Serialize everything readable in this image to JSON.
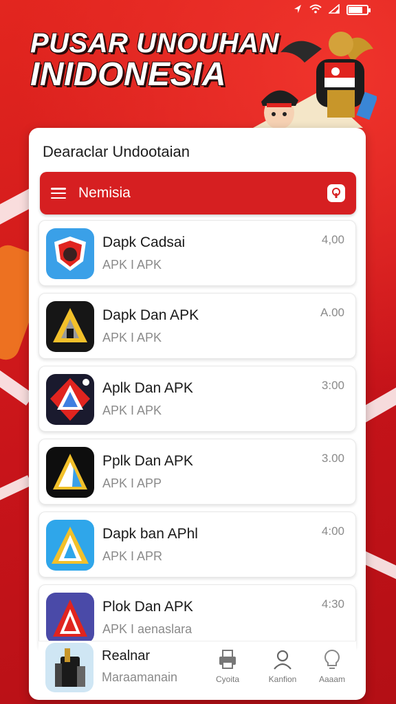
{
  "status_bar": {
    "icons": [
      "navigation-icon",
      "wifi-icon",
      "signal-icon",
      "battery-icon"
    ],
    "battery_level": 0.7
  },
  "hero": {
    "title_line1": "PUSAR UNOUHAN",
    "title_line2": "INIDONESIA"
  },
  "card": {
    "title": "Dearaclar Undootaian"
  },
  "menu": {
    "label": "Nemisia",
    "menu_icon": "hamburger-icon",
    "profile_icon": "profile-icon"
  },
  "apps": [
    {
      "name": "Dapk Cadsai",
      "sub": "APK I APK",
      "version": "4,00",
      "icon": "shield-icon"
    },
    {
      "name": "Dapk Dan APK",
      "sub": "APK I APK",
      "version": "A.00",
      "icon": "triangle-dark-icon"
    },
    {
      "name": "Aplk Dan APK",
      "sub": "APK I APK",
      "version": "3:00",
      "icon": "triangle-red-icon"
    },
    {
      "name": "Pplk Dan APK",
      "sub": "APK I APP",
      "version": "3.00",
      "icon": "triangle-black-icon"
    },
    {
      "name": "Dapk ban APhl",
      "sub": "APK I APR",
      "version": "4:00",
      "icon": "triangle-blue-icon"
    },
    {
      "name": "Plok Dan APK",
      "sub": "APK I aenaslara",
      "version": "4:30",
      "icon": "triangle-purple-icon"
    }
  ],
  "bottom_nav": {
    "featured": {
      "title": "Realnar",
      "sub": "Maraamanain",
      "icon": "brush-icon"
    },
    "tabs": [
      {
        "label": "Cyoita",
        "icon": "printer-icon"
      },
      {
        "label": "Kanfion",
        "icon": "user-icon"
      },
      {
        "label": "Aaaam",
        "icon": "lightbulb-icon"
      }
    ]
  },
  "colors": {
    "brand_red": "#d61f21",
    "background_red": "#d81e1e",
    "text_dark": "#1a1a1a",
    "text_muted": "#8a8a8a"
  }
}
